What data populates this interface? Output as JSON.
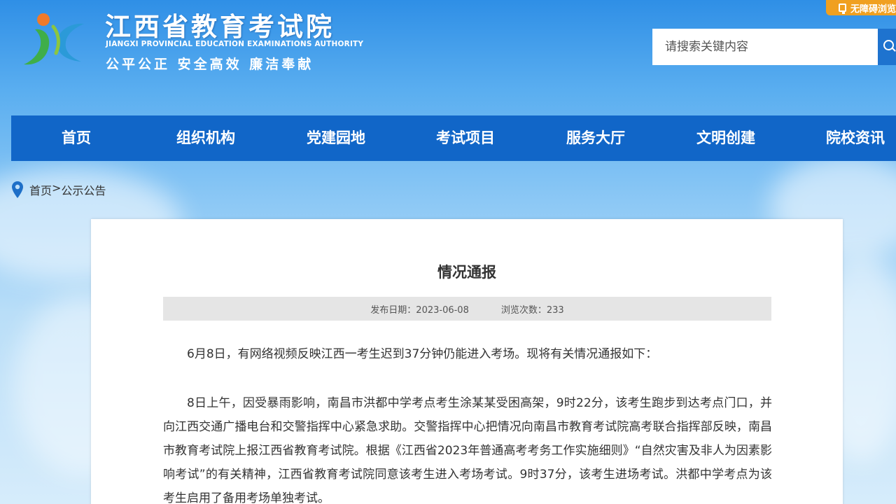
{
  "header": {
    "title": "江西省教育考试院",
    "subtitle": "JIANGXI PROVINCIAL EDUCATION EXAMINATIONS AUTHORITY",
    "motto": "公平公正  安全高效  廉洁奉献",
    "logo_icon": "jx-logo-icon"
  },
  "accessibility": {
    "label": "无障碍浏览",
    "icon": "monitor-icon"
  },
  "search": {
    "placeholder": "请搜索关键内容",
    "icon": "search-icon"
  },
  "nav": {
    "items": [
      {
        "label": "首页"
      },
      {
        "label": "组织机构"
      },
      {
        "label": "党建园地"
      },
      {
        "label": "考试项目"
      },
      {
        "label": "服务大厅"
      },
      {
        "label": "文明创建"
      },
      {
        "label": "院校资讯"
      }
    ]
  },
  "breadcrumb": {
    "home": "首页",
    "sep": ">",
    "current": "公示公告"
  },
  "article": {
    "title": "情况通报",
    "date_label": "发布日期：",
    "date": "2023-06-08",
    "views_label": "浏览次数：",
    "views": "233",
    "paragraphs": [
      "6月8日，有网络视频反映江西一考生迟到37分钟仍能进入考场。现将有关情况通报如下：",
      "8日上午，因受暴雨影响，南昌市洪都中学考点考生涂某某受困高架，9时22分，该考生跑步到达考点门口，并向江西交通广播电台和交警指挥中心紧急求助。交警指挥中心把情况向南昌市教育考试院高考联合指挥部反映，南昌市教育考试院上报江西省教育考试院。根据《江西省2023年普通高考考务工作实施细则》“自然灾害及非人为因素影响考试”的有关精神，江西省教育考试院同意该考生进入考场考试。9时37分，该考生进场考试。洪都中学考点为该考生启用了备用考场单独考试。"
    ]
  },
  "colors": {
    "nav_bg": "#1166c8",
    "accent_orange": "#f0a020",
    "search_btn": "#1e73cf"
  }
}
